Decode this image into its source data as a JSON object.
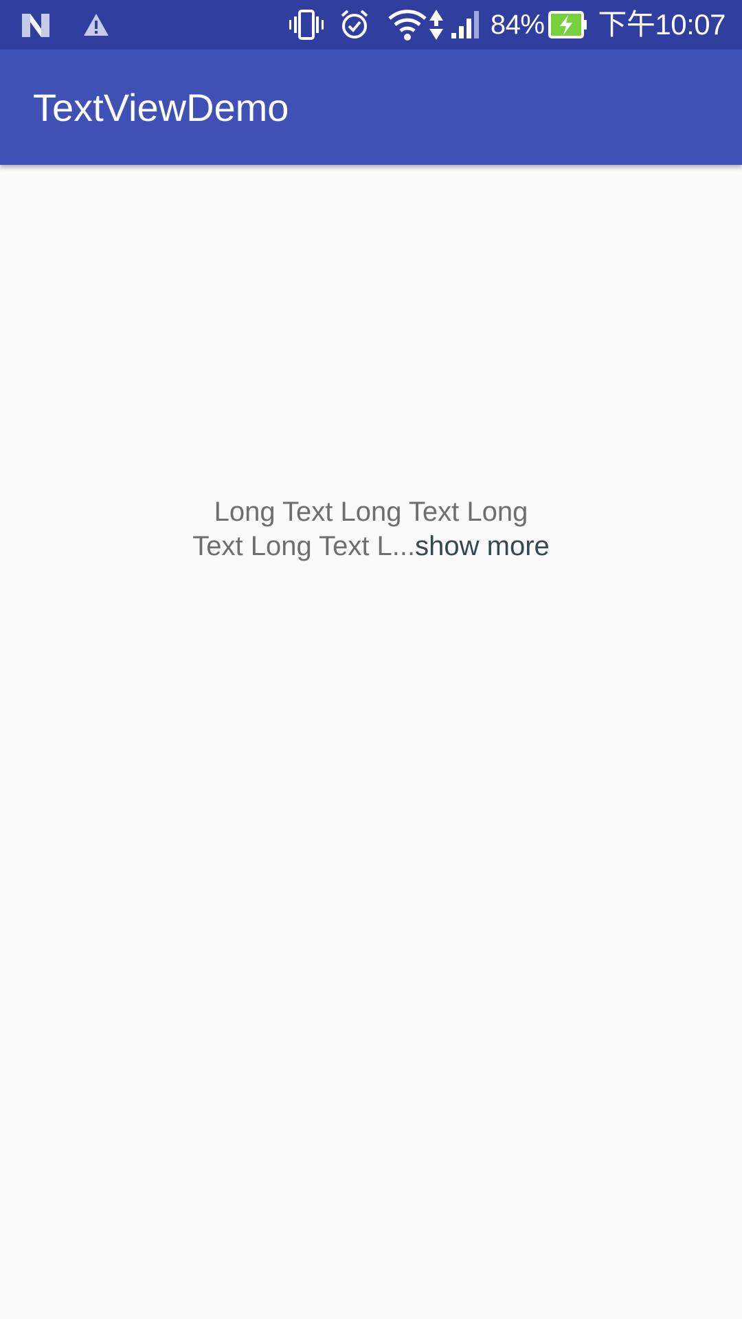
{
  "status_bar": {
    "battery_percent": "84%",
    "time": "下午10:07",
    "background_color": "#303F9F",
    "icons_left": [
      "n-logo-icon",
      "warning-icon"
    ],
    "icons_right": [
      "vibrate-icon",
      "alarm-icon",
      "wifi-icon",
      "data-arrows-icon",
      "signal-icon",
      "battery-charging-icon"
    ]
  },
  "app_bar": {
    "title": "TextViewDemo",
    "background_color": "#3F51B5"
  },
  "content": {
    "text_line_1": "Long Text Long Text Long",
    "text_line_2": "Text Long Text L...",
    "show_more_label": "show more",
    "text_color": "#6E6E6E",
    "link_color": "#37474F"
  }
}
